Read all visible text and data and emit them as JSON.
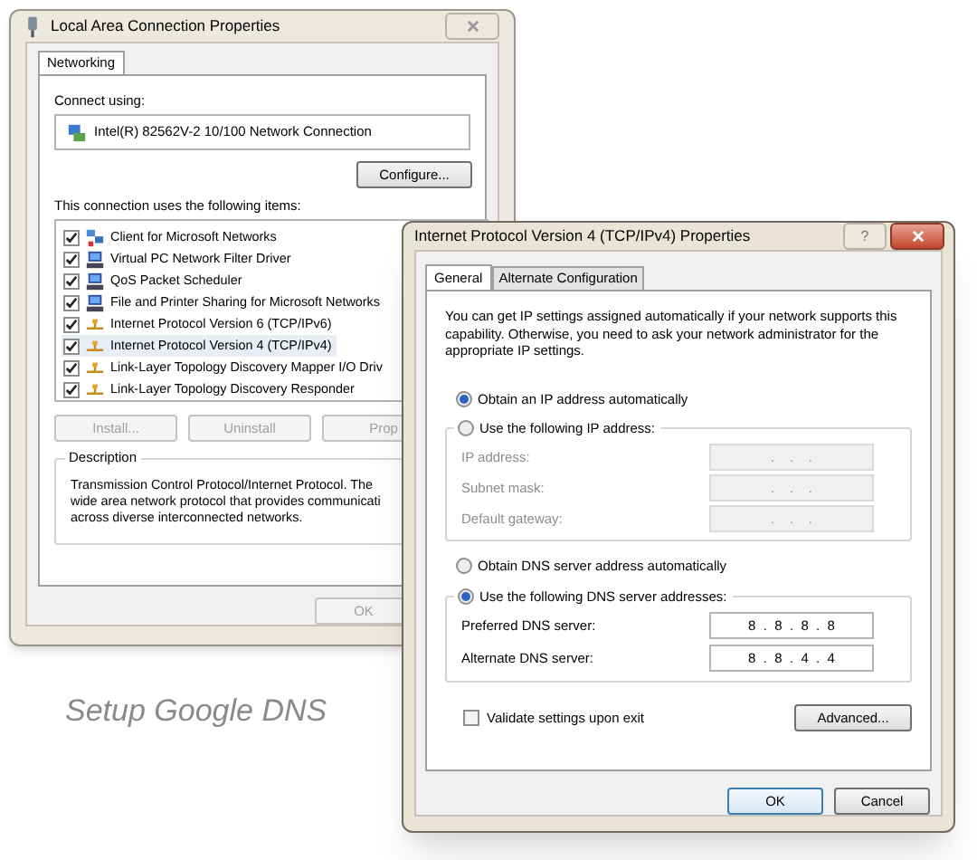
{
  "back_window": {
    "title": "Local Area Connection Properties",
    "tabs": [
      {
        "label": "Networking",
        "selected": true
      }
    ],
    "connect_using_label": "Connect using:",
    "adapter": "Intel(R) 82562V-2 10/100 Network Connection",
    "configure_button": "Configure...",
    "items_label": "This connection uses the following items:",
    "items": [
      {
        "label": "Client for Microsoft Networks",
        "checked": true,
        "selected": false,
        "kind": "client"
      },
      {
        "label": "Virtual PC Network Filter Driver",
        "checked": true,
        "selected": false,
        "kind": "service"
      },
      {
        "label": "QoS Packet Scheduler",
        "checked": true,
        "selected": false,
        "kind": "service"
      },
      {
        "label": "File and Printer Sharing for Microsoft Networks",
        "checked": true,
        "selected": false,
        "kind": "service"
      },
      {
        "label": "Internet Protocol Version 6 (TCP/IPv6)",
        "checked": true,
        "selected": false,
        "kind": "protocol"
      },
      {
        "label": "Internet Protocol Version 4 (TCP/IPv4)",
        "checked": true,
        "selected": true,
        "kind": "protocol"
      },
      {
        "label": "Link-Layer Topology Discovery Mapper I/O Driv",
        "checked": true,
        "selected": false,
        "kind": "protocol"
      },
      {
        "label": "Link-Layer Topology Discovery Responder",
        "checked": true,
        "selected": false,
        "kind": "protocol"
      }
    ],
    "buttons": [
      {
        "label": "Install...",
        "disabled": true
      },
      {
        "label": "Uninstall",
        "disabled": true
      },
      {
        "label": "Prop",
        "disabled": true
      }
    ],
    "description": {
      "title": "Description",
      "lines": [
        "Transmission Control Protocol/Internet Protocol. The",
        "wide area network protocol that provides communicati",
        "across diverse interconnected networks."
      ]
    },
    "ok_button": {
      "label": "OK",
      "disabled": true
    }
  },
  "front_window": {
    "title": "Internet Protocol Version 4 (TCP/IPv4) Properties",
    "help_button": "?",
    "tabs": [
      {
        "label": "General",
        "selected": true
      },
      {
        "label": "Alternate Configuration",
        "selected": false
      }
    ],
    "intro": "You can get IP settings assigned automatically if your network supports this capability. Otherwise, you need to ask your network administrator for the appropriate IP settings.",
    "ip_options": [
      {
        "label": "Obtain an IP address automatically",
        "selected": true
      },
      {
        "label": "Use the following IP address:",
        "selected": false
      }
    ],
    "ip_fields": [
      {
        "label": "IP address:",
        "value": ".    .    .",
        "disabled": true
      },
      {
        "label": "Subnet mask:",
        "value": ".    .    .",
        "disabled": true
      },
      {
        "label": "Default gateway:",
        "value": ".    .    .",
        "disabled": true
      }
    ],
    "dns_options": [
      {
        "label": "Obtain DNS server address automatically",
        "selected": false
      },
      {
        "label": "Use the following DNS server addresses:",
        "selected": true
      }
    ],
    "dns_fields": [
      {
        "label": "Preferred DNS server:",
        "value": "8  .  8  .  8  .  8",
        "disabled": false
      },
      {
        "label": "Alternate DNS server:",
        "value": "8  .  8  .  4  .  4",
        "disabled": false
      }
    ],
    "validate": {
      "label": "Validate settings upon exit",
      "checked": false
    },
    "advanced_button": "Advanced...",
    "buttons": [
      {
        "label": "OK",
        "default": true
      },
      {
        "label": "Cancel",
        "default": false
      }
    ]
  },
  "caption": "Setup Google DNS"
}
